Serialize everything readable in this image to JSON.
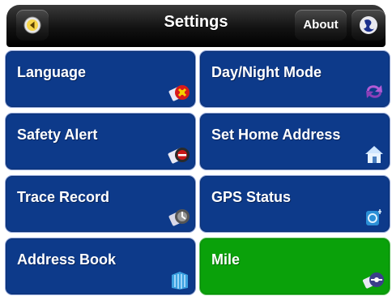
{
  "header": {
    "title": "Settings",
    "about_label": "About"
  },
  "tiles": [
    {
      "label": "Language",
      "icon": "language-flag-icon",
      "selected": false
    },
    {
      "label": "Day/Night Mode",
      "icon": "day-night-arrows-icon",
      "selected": false
    },
    {
      "label": "Safety Alert",
      "icon": "safety-alert-icon",
      "selected": false
    },
    {
      "label": "Set Home Address",
      "icon": "home-icon",
      "selected": false
    },
    {
      "label": "Trace Record",
      "icon": "trace-record-icon",
      "selected": false
    },
    {
      "label": "GPS Status",
      "icon": "gps-status-icon",
      "selected": false
    },
    {
      "label": "Address Book",
      "icon": "address-book-icon",
      "selected": false
    },
    {
      "label": "Mile",
      "icon": "distance-unit-icon",
      "selected": true
    }
  ],
  "colors": {
    "tile_blue": "#0d3a8a",
    "tile_selected_green": "#0aa10a",
    "title_bar": "#121212"
  }
}
